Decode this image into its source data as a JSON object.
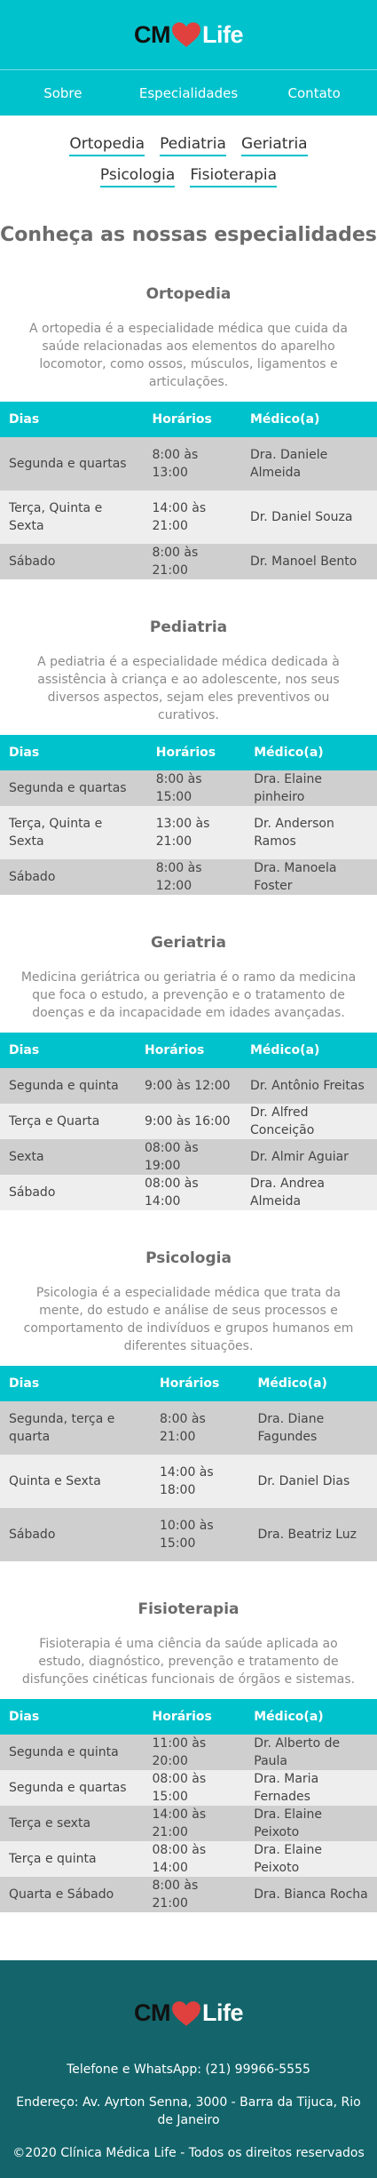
{
  "brand": {
    "logo_left": "CM",
    "logo_right": "Life",
    "heart_color": "#e0413e",
    "primary_color": "#00c2cc",
    "footer_color": "#13656b"
  },
  "nav": {
    "items": [
      "Sobre",
      "Especialidades",
      "Contato"
    ]
  },
  "specialty_links": [
    "Ortopedia",
    "Pediatria",
    "Geriatria",
    "Psicologia",
    "Fisioterapia"
  ],
  "main_title": "Conheça as nossas especialidades",
  "sections": [
    {
      "title": "Ortopedia",
      "description": "A ortopedia é a especialidade médica que cuida da saúde relacionadas aos elementos do aparelho locomotor, como ossos, músculos, ligamentos e articulações.",
      "headers": [
        "Dias",
        "Horários",
        "Médico(a)"
      ],
      "rows": [
        [
          "Segunda e quartas",
          "8:00 às 13:00",
          "Dra. Daniele Almeida"
        ],
        [
          "Terça, Quinta e Sexta",
          "14:00 às 21:00",
          "Dr. Daniel Souza"
        ],
        [
          "Sábado",
          "8:00 às 21:00",
          "Dr. Manoel Bento"
        ]
      ]
    },
    {
      "title": "Pediatria",
      "description": "A pediatria é a especialidade médica dedicada à assistência à criança e ao adolescente, nos seus diversos aspectos, sejam eles preventivos ou curativos.",
      "headers": [
        "Dias",
        "Horários",
        "Médico(a)"
      ],
      "rows": [
        [
          "Segunda e quartas",
          "8:00 às 15:00",
          "Dra. Elaine pinheiro"
        ],
        [
          "Terça, Quinta e Sexta",
          "13:00 às 21:00",
          "Dr. Anderson Ramos"
        ],
        [
          "Sábado",
          "8:00 às 12:00",
          "Dra. Manoela Foster"
        ]
      ]
    },
    {
      "title": "Geriatria",
      "description": "Medicina geriátrica ou geriatria é o ramo da medicina que foca o estudo, a prevenção e o tratamento de doenças e da incapacidade em idades avançadas.",
      "headers": [
        "Dias",
        "Horários",
        "Médico(a)"
      ],
      "rows": [
        [
          "Segunda e quinta",
          "9:00 às 12:00",
          "Dr. Antônio Freitas"
        ],
        [
          "Terça e Quarta",
          "9:00 às 16:00",
          "Dr. Alfred Conceição"
        ],
        [
          "Sexta",
          "08:00 às 19:00",
          "Dr. Almir Aguiar"
        ],
        [
          "Sábado",
          "08:00 às 14:00",
          "Dra. Andrea Almeida"
        ]
      ]
    },
    {
      "title": "Psicologia",
      "description": "Psicologia é a especialidade médica que trata da mente, do estudo e análise de seus processos e comportamento de indivíduos e grupos humanos em diferentes situações.",
      "headers": [
        "Dias",
        "Horários",
        "Médico(a)"
      ],
      "rows": [
        [
          "Segunda, terça e quarta",
          "8:00 às 21:00",
          "Dra. Diane Fagundes"
        ],
        [
          "Quinta e Sexta",
          "14:00 às 18:00",
          "Dr. Daniel Dias"
        ],
        [
          "Sábado",
          "10:00 às 15:00",
          "Dra. Beatriz Luz"
        ]
      ]
    },
    {
      "title": "Fisioterapia",
      "description": "Fisioterapia é uma ciência da saúde aplicada ao estudo, diagnóstico, prevenção e tratamento de disfunções cinéticas funcionais de órgãos e sistemas.",
      "headers": [
        "Dias",
        "Horários",
        "Médico(a)"
      ],
      "rows": [
        [
          "Segunda e quinta",
          "11:00 às 20:00",
          "Dr. Alberto de Paula"
        ],
        [
          "Segunda e quartas",
          "08:00 às 15:00",
          "Dra. Maria Fernades"
        ],
        [
          "Terça e sexta",
          "14:00 às 21:00",
          "Dra. Elaine Peixoto"
        ],
        [
          "Terça e quinta",
          "08:00 às 14:00",
          "Dra. Elaine Peixoto"
        ],
        [
          "Quarta e Sábado",
          "8:00 às 21:00",
          "Dra. Bianca Rocha"
        ]
      ]
    }
  ],
  "footer": {
    "phone": "Telefone e WhatsApp: (21) 99966-5555",
    "address": "Endereço: Av. Ayrton Senna, 3000 - Barra da Tijuca, Rio de Janeiro",
    "copyright": "©2020 Clínica Médica Life - Todos os direitos reservados"
  }
}
